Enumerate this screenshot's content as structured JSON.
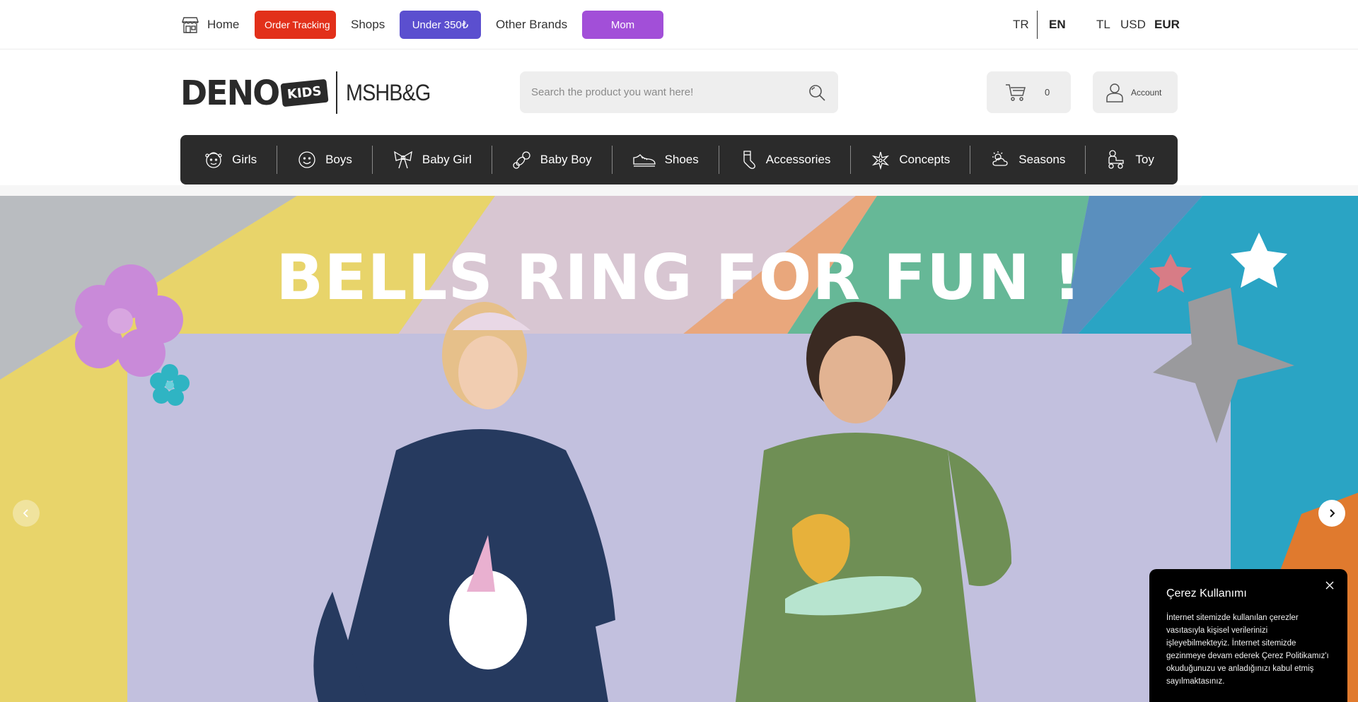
{
  "topbar": {
    "home_label": "Home",
    "order_tracking_label": "Order Tracking",
    "shops_label": "Shops",
    "under_label": "Under 350₺",
    "other_brands_label": "Other Brands",
    "mom_label": "Mom",
    "lang_tr": "TR",
    "lang_en": "EN",
    "cur_tl": "TL",
    "cur_usd": "USD",
    "cur_eur": "EUR"
  },
  "colors": {
    "order_tracking": "#e2301a",
    "under": "#5b4fcf",
    "mom": "#a24fd8",
    "nav_bg": "#2b2b2b"
  },
  "header": {
    "logo_main": "DENO",
    "logo_tag": "KIDS",
    "logo_second": "MSHB&G",
    "search_placeholder": "Search the product you want here!",
    "cart_count": "0",
    "account_label": "Account"
  },
  "categories": [
    {
      "label": "Girls",
      "icon": "girl-face-icon"
    },
    {
      "label": "Boys",
      "icon": "boy-face-icon"
    },
    {
      "label": "Baby Girl",
      "icon": "bow-icon"
    },
    {
      "label": "Baby Boy",
      "icon": "pacifier-icon"
    },
    {
      "label": "Shoes",
      "icon": "shoe-icon"
    },
    {
      "label": "Accessories",
      "icon": "sock-icon"
    },
    {
      "label": "Concepts",
      "icon": "sparkle-icon"
    },
    {
      "label": "Seasons",
      "icon": "sun-cloud-icon"
    },
    {
      "label": "Toy",
      "icon": "toy-car-icon"
    }
  ],
  "hero": {
    "title": "BELLS RING FOR FUN !"
  },
  "cookie": {
    "title": "Çerez Kullanımı",
    "text": "İnternet sitemizde kullanılan çerezler vasıtasıyla kişisel verilerinizi işleyebilmekteyiz. İnternet sitemizde gezinmeye devam ederek Çerez Politikamız'ı okuduğunuzu ve anladığınızı kabul etmiş sayılmaktasınız."
  }
}
